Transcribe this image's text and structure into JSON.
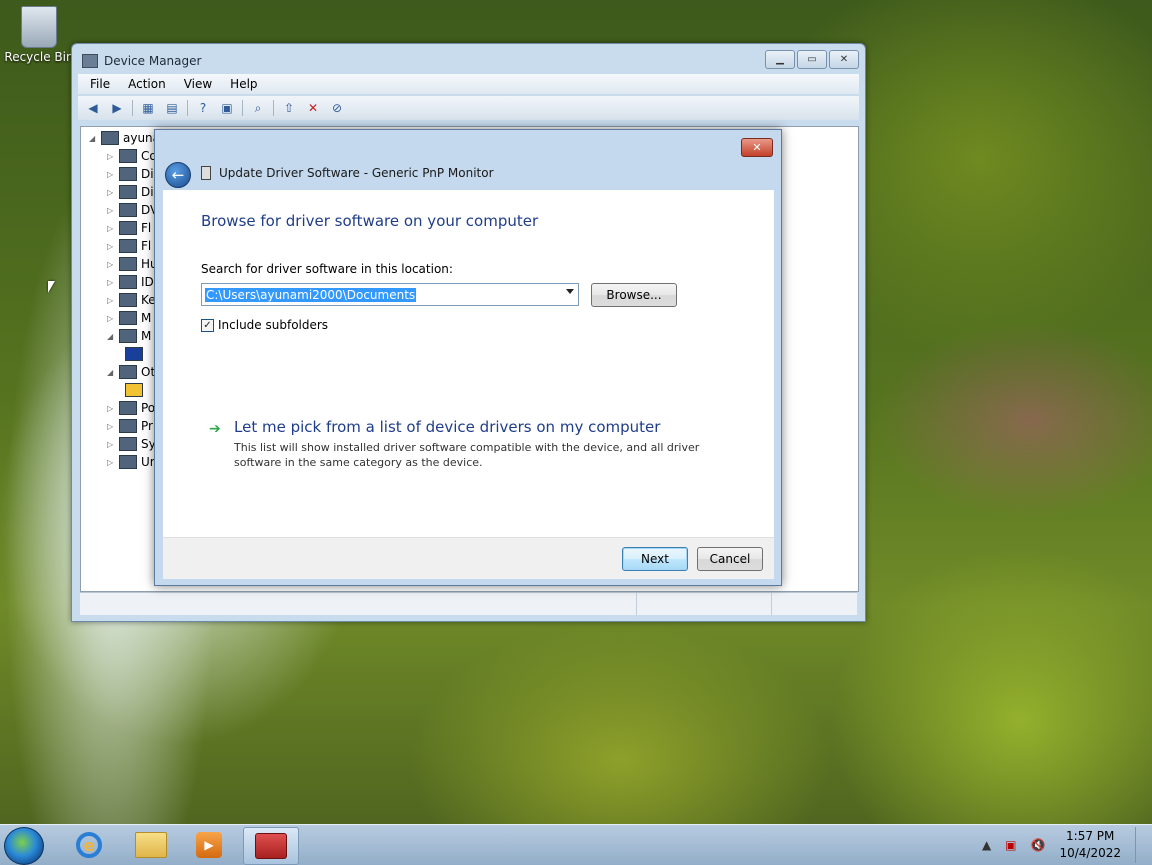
{
  "desktop": {
    "recycle_bin_label": "Recycle Bin"
  },
  "device_manager": {
    "title": "Device Manager",
    "menu": [
      "File",
      "Action",
      "View",
      "Help"
    ],
    "tree": [
      {
        "label": "ayuna"
      },
      {
        "label": "Co"
      },
      {
        "label": "Di"
      },
      {
        "label": "Di"
      },
      {
        "label": "DV"
      },
      {
        "label": "Fl"
      },
      {
        "label": "Fl"
      },
      {
        "label": "Hu"
      },
      {
        "label": "ID"
      },
      {
        "label": "Ke"
      },
      {
        "label": "M"
      },
      {
        "label": "M"
      },
      {
        "label": ""
      },
      {
        "label": "Ot"
      },
      {
        "label": ""
      },
      {
        "label": "Po"
      },
      {
        "label": "Pr"
      },
      {
        "label": "Sy"
      },
      {
        "label": "Ur"
      }
    ]
  },
  "dialog": {
    "title": "Update Driver Software - Generic PnP Monitor",
    "close_label": "✕",
    "heading": "Browse for driver software on your computer",
    "search_label": "Search for driver software in this location:",
    "path_value": "C:\\Users\\ayunami2000\\Documents",
    "browse_label": "Browse...",
    "include_subfolders_label": "Include subfolders",
    "include_subfolders_checked": true,
    "pick_link": "Let me pick from a list of device drivers on my computer",
    "pick_description": "This list will show installed driver software compatible with the device, and all driver software in the same category as the device.",
    "next_label": "Next",
    "cancel_label": "Cancel"
  },
  "taskbar": {
    "time": "1:57 PM",
    "date": "10/4/2022",
    "icons": [
      "start-orb-icon",
      "internet-explorer-icon",
      "file-explorer-icon",
      "media-player-icon",
      "device-manager-toolbox-icon"
    ]
  }
}
